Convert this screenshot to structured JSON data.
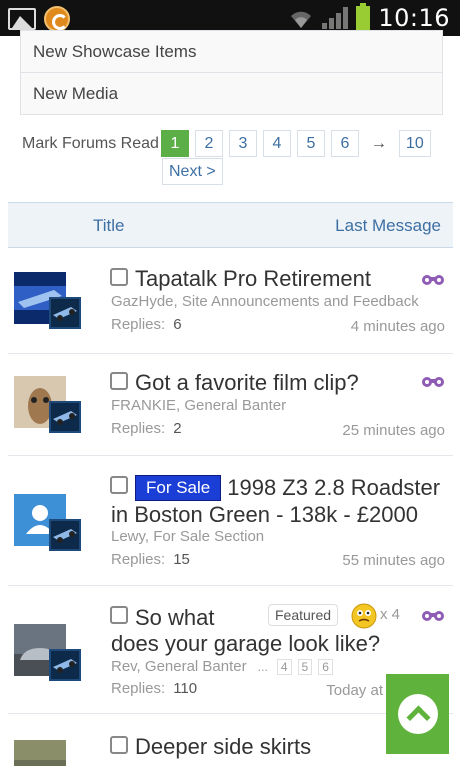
{
  "status_bar": {
    "time": "10:16"
  },
  "menu": {
    "items": [
      {
        "label": "New Showcase Items"
      },
      {
        "label": "New Media"
      }
    ]
  },
  "pagination": {
    "mark_read": "Mark Forums Read",
    "pages": [
      "1",
      "2",
      "3",
      "4",
      "5",
      "6"
    ],
    "current_page": "1",
    "arrow": "→",
    "last_page": "10",
    "next_label": "Next >"
  },
  "table_header": {
    "title": "Title",
    "last_message": "Last Message"
  },
  "threads": [
    {
      "title": "Tapatalk Pro Retirement",
      "meta": "GazHyde, Site Announcements and Feedback",
      "replies_label": "Replies:",
      "replies": "6",
      "time": "4 minutes ago"
    },
    {
      "title": "Got a favorite film clip?",
      "meta": "FRANKIE, General Banter",
      "replies_label": "Replies:",
      "replies": "2",
      "time": "25 minutes ago"
    },
    {
      "prefix": "For Sale",
      "title_line1": "1998 Z3 2.8 Roadster",
      "title_line2": "in Boston Green - 138k - £2000",
      "meta": "Lewy, For Sale Section",
      "replies_label": "Replies:",
      "replies": "15",
      "time": "55 minutes ago"
    },
    {
      "title_line1": "So what",
      "title_line2": "does your garage look like?",
      "featured": "Featured",
      "reaction_count": "x 4",
      "meta": "Rev, General Banter",
      "mini_pages_ellipsis": "...",
      "mini_pages": [
        "4",
        "5",
        "6"
      ],
      "replies_label": "Replies:",
      "replies": "110",
      "time": "Today at"
    },
    {
      "title": "Deeper side skirts"
    }
  ],
  "colors": {
    "accent_blue": "#3d6fa3",
    "current_page_green": "#5cae47",
    "for_sale_blue": "#1b3fd6",
    "to_top_green": "#5fb33d",
    "watch_purple": "#8e5bb5"
  }
}
